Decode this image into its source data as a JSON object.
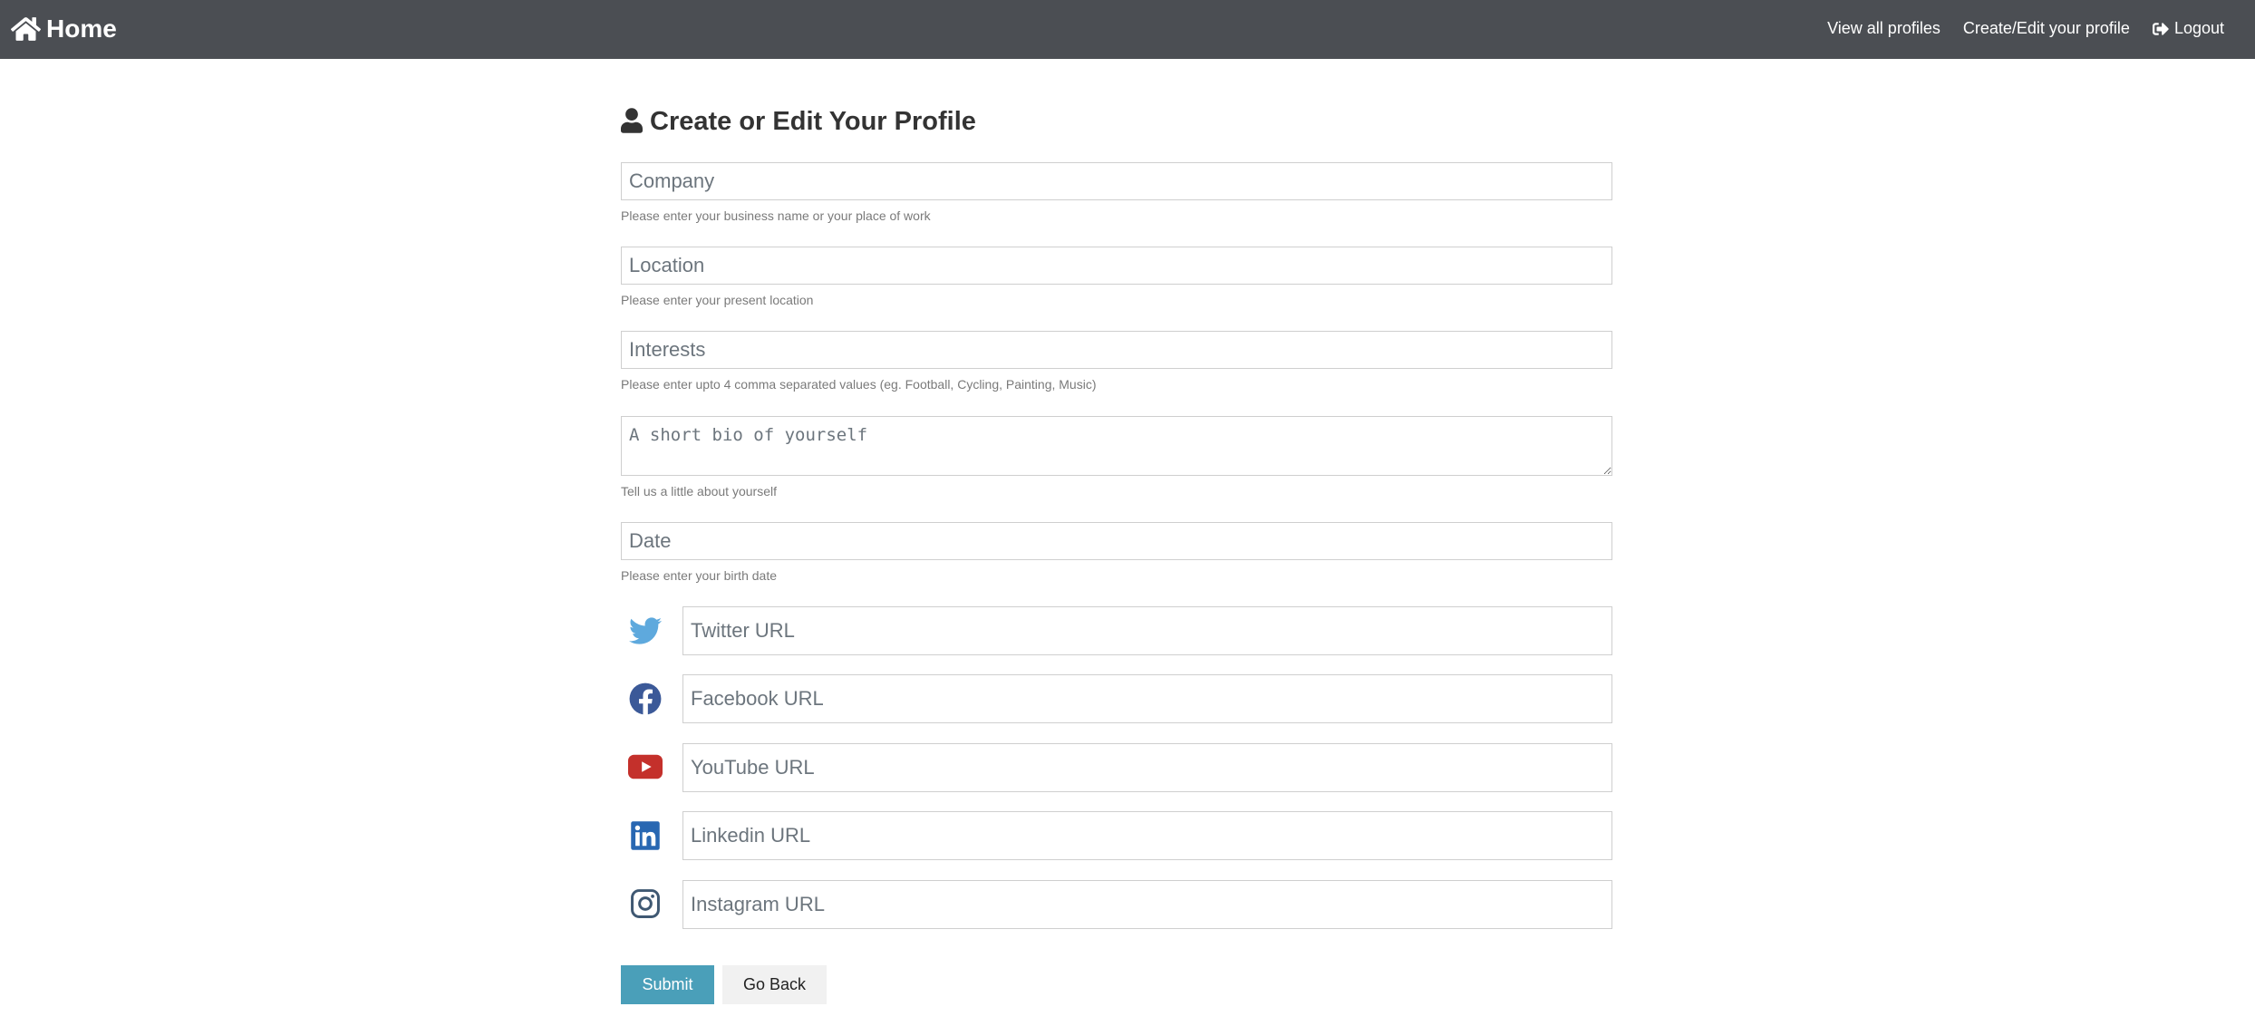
{
  "navbar": {
    "brand_label": "Home",
    "brand_icon": "home-icon",
    "links": [
      {
        "label": "View all profiles"
      },
      {
        "label": "Create/Edit your profile"
      },
      {
        "label": "Logout",
        "icon": "sign-out-icon"
      }
    ],
    "background": "#4b4e53"
  },
  "page": {
    "title": "Create or Edit Your Profile",
    "title_icon": "user-icon"
  },
  "form": {
    "company": {
      "placeholder": "Company",
      "help": "Please enter your business name or your place of work"
    },
    "location": {
      "placeholder": "Location",
      "help": "Please enter your present location"
    },
    "interests": {
      "placeholder": "Interests",
      "help": "Please enter upto 4 comma separated values (eg. Football, Cycling, Painting, Music)"
    },
    "bio": {
      "placeholder": "A short bio of yourself",
      "help": "Tell us a little about yourself"
    },
    "date": {
      "placeholder": "Date",
      "help": "Please enter your birth date"
    },
    "social": {
      "twitter": {
        "placeholder": "Twitter URL",
        "icon": "twitter-icon",
        "color": "#5ea9dd"
      },
      "facebook": {
        "placeholder": "Facebook URL",
        "icon": "facebook-icon",
        "color": "#3b5998"
      },
      "youtube": {
        "placeholder": "YouTube URL",
        "icon": "youtube-icon",
        "color": "#c4302b"
      },
      "linkedin": {
        "placeholder": "Linkedin URL",
        "icon": "linkedin-icon",
        "color": "#2867b2"
      },
      "instagram": {
        "placeholder": "Instagram URL",
        "icon": "instagram-icon",
        "color": "#3f5872"
      }
    },
    "submit_label": "Submit",
    "back_label": "Go Back",
    "submit_color": "#4a9fb9"
  }
}
